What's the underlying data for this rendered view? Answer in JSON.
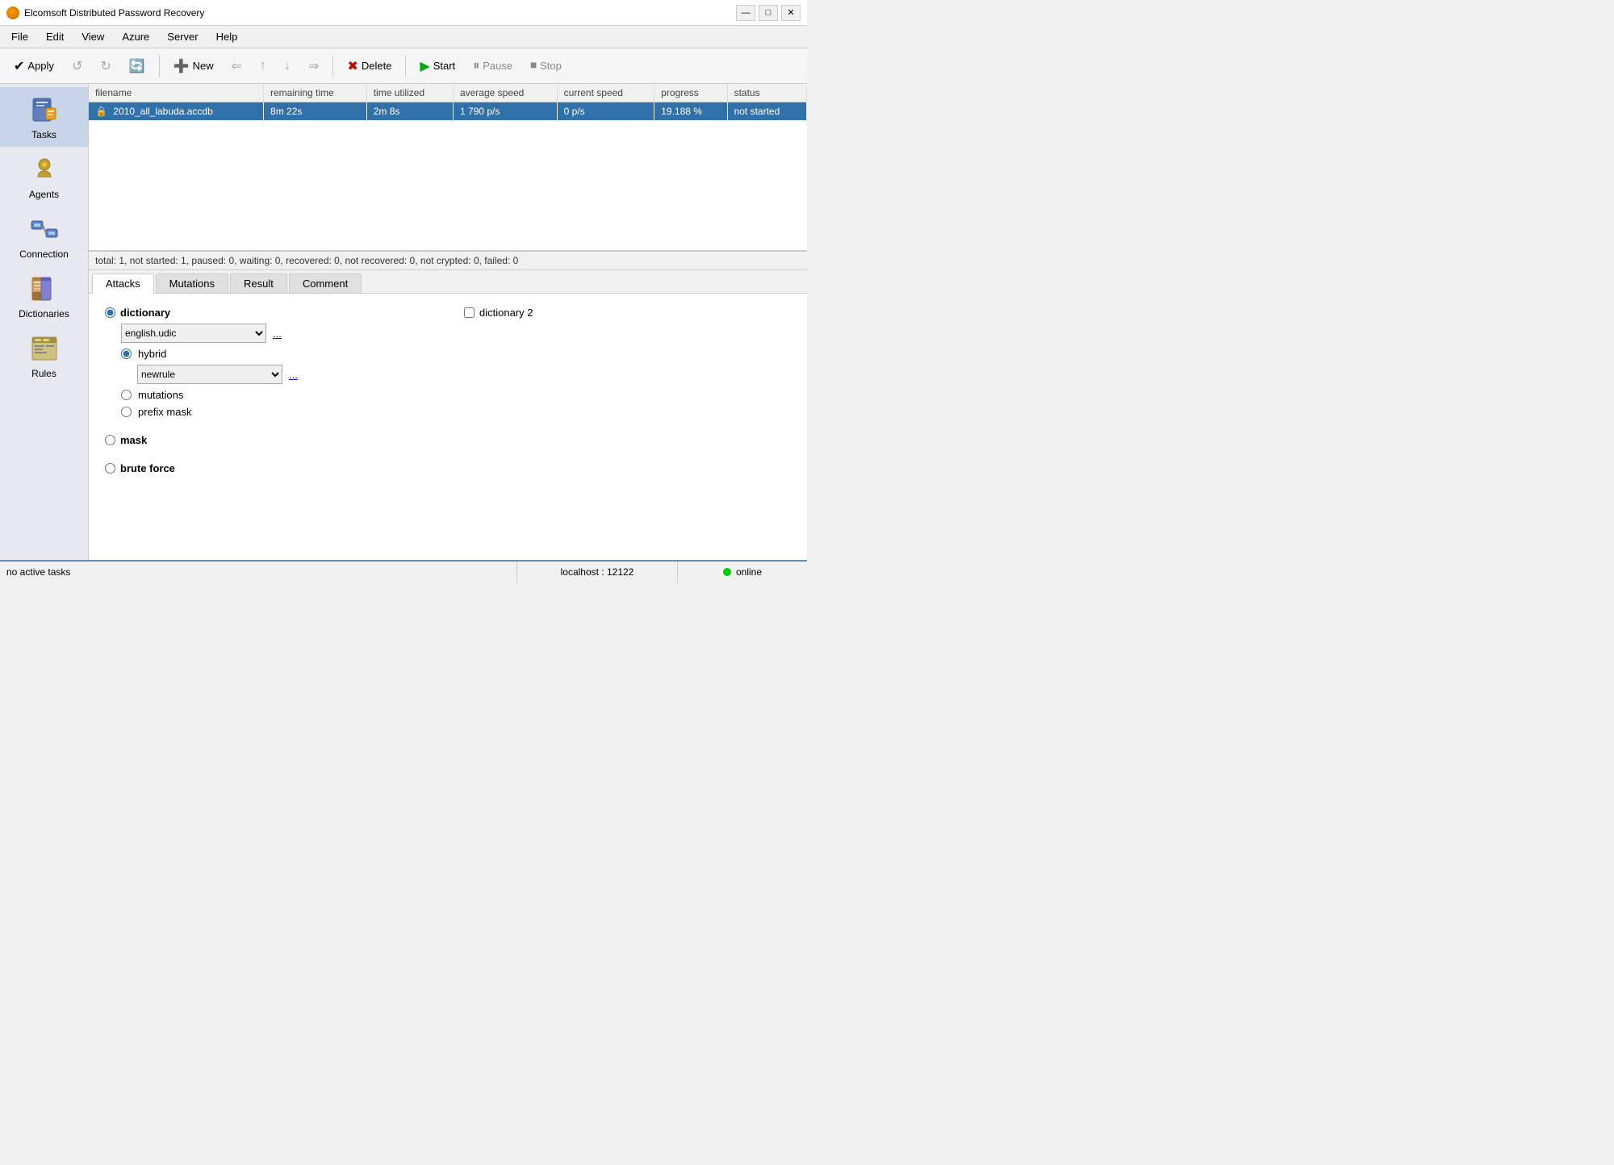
{
  "app": {
    "title": "Elcomsoft Distributed Password Recovery"
  },
  "title_controls": {
    "minimize": "—",
    "restore": "□",
    "close": "✕"
  },
  "menu": {
    "items": [
      "File",
      "Edit",
      "View",
      "Azure",
      "Server",
      "Help"
    ]
  },
  "toolbar": {
    "apply": "Apply",
    "new": "New",
    "delete": "Delete",
    "start": "Start",
    "pause": "Pause",
    "stop": "Stop"
  },
  "sidebar": {
    "items": [
      {
        "id": "tasks",
        "label": "Tasks",
        "active": true
      },
      {
        "id": "agents",
        "label": "Agents",
        "active": false
      },
      {
        "id": "connection",
        "label": "Connection",
        "active": false
      },
      {
        "id": "dictionaries",
        "label": "Dictionaries",
        "active": false
      },
      {
        "id": "rules",
        "label": "Rules",
        "active": false
      }
    ]
  },
  "table": {
    "headers": [
      "filename",
      "remaining time",
      "time utilized",
      "average speed",
      "current speed",
      "progress",
      "status"
    ],
    "rows": [
      {
        "filename": "2010_all_labuda.accdb",
        "remaining_time": "8m 22s",
        "time_utilized": "2m 8s",
        "average_speed": "1 790  p/s",
        "current_speed": "0  p/s",
        "progress": "19.188 %",
        "status": "not started",
        "selected": true
      }
    ]
  },
  "task_summary": "total: 1,  not started: 1,  paused: 0,  waiting: 0,  recovered: 0,  not recovered: 0,  not crypted: 0,  failed: 0",
  "tabs": {
    "items": [
      "Attacks",
      "Mutations",
      "Result",
      "Comment"
    ],
    "active": "Attacks"
  },
  "attacks": {
    "options": [
      {
        "id": "dictionary",
        "label": "dictionary",
        "checked": true,
        "bold": true
      },
      {
        "id": "mask",
        "label": "mask",
        "checked": false,
        "bold": true
      },
      {
        "id": "brute_force",
        "label": "brute force",
        "checked": false,
        "bold": true
      }
    ],
    "dict1_label": "dictionary",
    "dict1_value": "english.udic",
    "dict1_options": [
      "english.udic"
    ],
    "dict1_ellipsis": "...",
    "dict2_label": "dictionary 2",
    "dict2_checked": false,
    "hybrid_label": "hybrid",
    "hybrid_checked": true,
    "hybrid_value": "newrule",
    "hybrid_options": [
      "newrule"
    ],
    "hybrid_ellipsis": "...",
    "mutations_label": "mutations",
    "mutations_checked": false,
    "prefix_mask_label": "prefix mask",
    "prefix_mask_checked": false
  },
  "status_bar": {
    "left": "no active tasks",
    "mid": "localhost : 12122",
    "right": "online"
  }
}
